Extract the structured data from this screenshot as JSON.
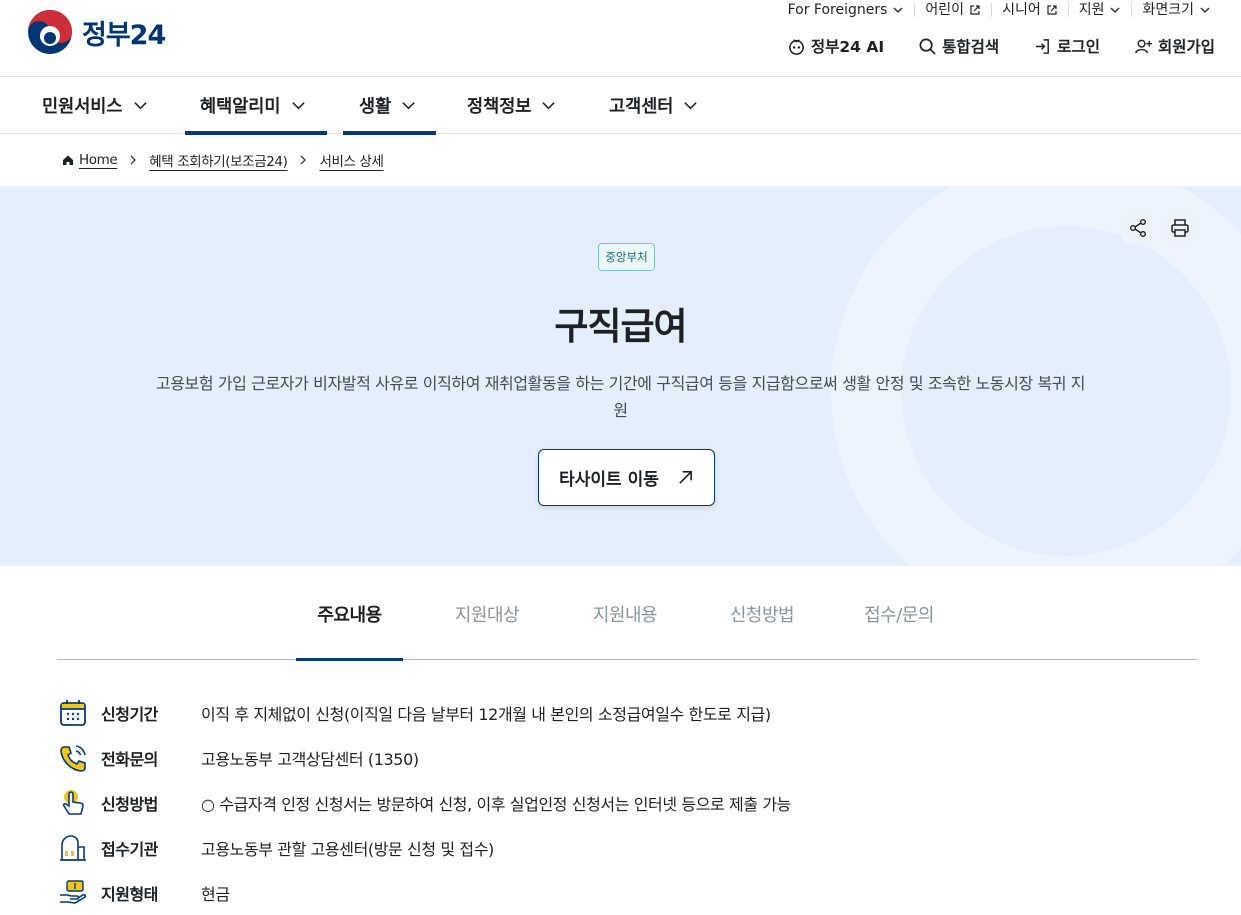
{
  "header": {
    "logo_text": "정부24",
    "top_links": [
      "For Foreigners",
      "어린이",
      "시니어",
      "지원",
      "화면크기"
    ],
    "util": {
      "ai": "정부24 AI",
      "search": "통합검색",
      "login": "로그인",
      "signup": "회원가입"
    }
  },
  "nav": {
    "items": [
      "민원서비스",
      "혜택알리미",
      "생활",
      "정책정보",
      "고객센터"
    ]
  },
  "breadcrumb": {
    "home": "Home",
    "level1": "혜택 조회하기(보조금24)",
    "level2": "서비스 상세"
  },
  "hero": {
    "badge": "중앙부처",
    "title": "구직급여",
    "description": "고용보험 가입 근로자가 비자발적 사유로 이직하여 재취업활동을 하는 기간에 구직급여 등을 지급함으로써 생활 안정 및 조속한 노동시장 복귀 지원",
    "site_button": "타사이트 이동"
  },
  "tabs": [
    "주요내용",
    "지원대상",
    "지원내용",
    "신청방법",
    "접수/문의"
  ],
  "info_rows": [
    {
      "label": "신청기간",
      "value": "이직 후 지체없이 신청(이직일 다음 날부터 12개월 내 본인의 소정급여일수 한도로 지급)"
    },
    {
      "label": "전화문의",
      "value": "고용노동부 고객상담센터 (1350)"
    },
    {
      "label": "신청방법",
      "value": "○ 수급자격 인정 신청서는 방문하여 신청, 이후 실업인정 신청서는 인터넷 등으로 제출 가능"
    },
    {
      "label": "접수기관",
      "value": "고용노동부 관할 고용센터(방문 신청 및 접수)"
    },
    {
      "label": "지원형태",
      "value": "현금"
    }
  ],
  "colors": {
    "primary": "#063a74",
    "hero_bg": "#e5eefc",
    "icon_yellow": "#f5c518"
  }
}
